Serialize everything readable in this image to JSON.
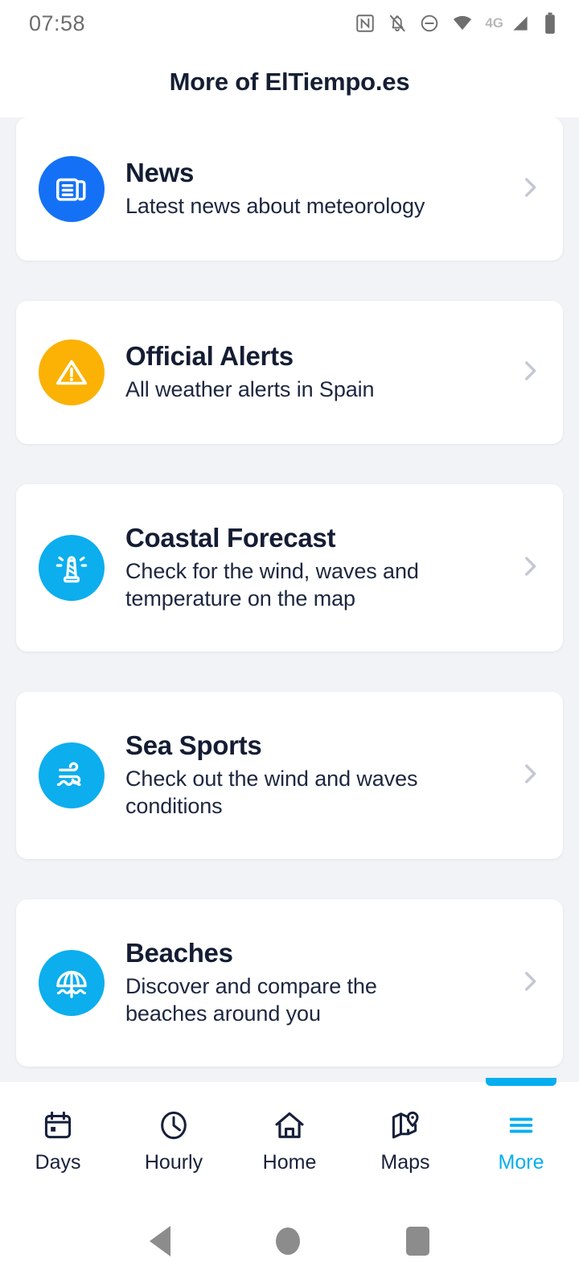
{
  "status_bar": {
    "time": "07:58",
    "network_label": "4G",
    "icons": [
      "nfc-icon",
      "notifications-muted-icon",
      "do-not-disturb-icon",
      "wifi-icon",
      "cellular-signal-icon",
      "battery-icon"
    ]
  },
  "header": {
    "title": "More of ElTiempo.es"
  },
  "colors": {
    "news": "#1471f5",
    "alerts": "#fbb205",
    "coastal": "#0caeed",
    "sea_sports": "#0caeed",
    "beaches": "#0caeed",
    "accent": "#06aeef",
    "page_background": "#f1f3f6",
    "title_text": "#141d33"
  },
  "menu": {
    "items": [
      {
        "title": "News",
        "description": "Latest news about meteorology",
        "icon": "newspaper-icon",
        "icon_color": "#1471f5"
      },
      {
        "title": "Official Alerts",
        "description": "All weather alerts in Spain",
        "icon": "warning-triangle-icon",
        "icon_color": "#fbb205"
      },
      {
        "title": "Coastal Forecast",
        "description": "Check for the wind, waves and temperature on the map",
        "icon": "lighthouse-icon",
        "icon_color": "#0caeed"
      },
      {
        "title": "Sea Sports",
        "description": "Check out the wind and waves conditions",
        "icon": "wind-wave-icon",
        "icon_color": "#0caeed"
      },
      {
        "title": "Beaches",
        "description": "Discover and compare the beaches around you",
        "icon": "beach-umbrella-icon",
        "icon_color": "#0caeed"
      }
    ]
  },
  "bottom_nav": {
    "items": [
      {
        "label": "Days",
        "icon": "calendar-icon",
        "active": false
      },
      {
        "label": "Hourly",
        "icon": "clock-icon",
        "active": false
      },
      {
        "label": "Home",
        "icon": "house-icon",
        "active": false
      },
      {
        "label": "Maps",
        "icon": "map-pin-icon",
        "active": false
      },
      {
        "label": "More",
        "icon": "hamburger-menu-icon",
        "active": true
      }
    ]
  },
  "system_nav": {
    "back": "back-button",
    "home": "home-button",
    "recents": "recents-button"
  }
}
